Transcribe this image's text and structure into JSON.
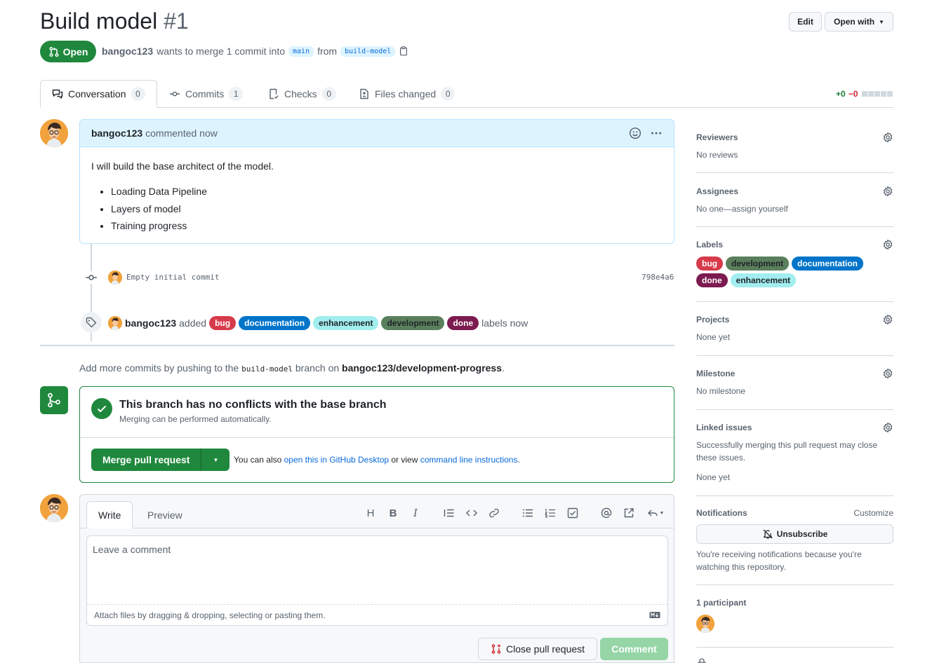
{
  "pr": {
    "title": "Build model",
    "number": "#1",
    "state": "Open",
    "author": "bangoc123",
    "merge_text_1": "wants to merge 1 commit into",
    "base": "main",
    "from_text": "from",
    "head": "build-model"
  },
  "header_buttons": {
    "edit": "Edit",
    "open_with": "Open with"
  },
  "tabs": [
    {
      "label": "Conversation",
      "count": "0"
    },
    {
      "label": "Commits",
      "count": "1"
    },
    {
      "label": "Checks",
      "count": "0"
    },
    {
      "label": "Files changed",
      "count": "0"
    }
  ],
  "diffstat": {
    "added": "+0",
    "removed": "−0"
  },
  "comment": {
    "author": "bangoc123",
    "meta": "commented now",
    "body": "I will build the base architect of the model.",
    "items": [
      "Loading Data Pipeline",
      "Layers of model",
      "Training progress"
    ]
  },
  "commit": {
    "message": "Empty initial commit",
    "sha": "798e4a6"
  },
  "label_event": {
    "author": "bangoc123",
    "verb": "added",
    "suffix": "labels now"
  },
  "labels": [
    {
      "name": "bug",
      "color": "#d73a4a",
      "text": "#ffffff"
    },
    {
      "name": "documentation",
      "color": "#0075ca",
      "text": "#ffffff"
    },
    {
      "name": "enhancement",
      "color": "#a2eeef",
      "text": "#1f2328"
    },
    {
      "name": "development",
      "color": "#5a7f5c",
      "text": "#1f2328"
    },
    {
      "name": "done",
      "color": "#7c1b4f",
      "text": "#ffffff"
    }
  ],
  "push_hint": {
    "prefix": "Add more commits by pushing to the",
    "branch": "build-model",
    "middle": "branch on",
    "repo": "bangoc123/development-progress",
    "suffix": "."
  },
  "merge": {
    "title": "This branch has no conflicts with the base branch",
    "subtitle": "Merging can be performed automatically.",
    "button": "Merge pull request",
    "also": "You can also",
    "desktop_link": "open this in GitHub Desktop",
    "or_view": "or view",
    "cli_link": "command line instructions",
    "end": "."
  },
  "editor": {
    "write_tab": "Write",
    "preview_tab": "Preview",
    "placeholder": "Leave a comment",
    "attach": "Attach files by dragging & dropping, selecting or pasting them.",
    "close_button": "Close pull request",
    "comment_button": "Comment"
  },
  "sidebar": {
    "reviewers": {
      "title": "Reviewers",
      "value": "No reviews"
    },
    "assignees": {
      "title": "Assignees",
      "value": "No one—assign yourself"
    },
    "labels_title": "Labels",
    "sidebar_labels": [
      {
        "name": "bug",
        "color": "#d73a4a",
        "text": "#ffffff"
      },
      {
        "name": "development",
        "color": "#5a7f5c",
        "text": "#1f2328"
      },
      {
        "name": "documentation",
        "color": "#0075ca",
        "text": "#ffffff"
      },
      {
        "name": "done",
        "color": "#7c1b4f",
        "text": "#ffffff"
      },
      {
        "name": "enhancement",
        "color": "#a2eeef",
        "text": "#1f2328"
      }
    ],
    "projects": {
      "title": "Projects",
      "value": "None yet"
    },
    "milestone": {
      "title": "Milestone",
      "value": "No milestone"
    },
    "linked": {
      "title": "Linked issues",
      "desc": "Successfully merging this pull request may close these issues.",
      "value": "None yet"
    },
    "notifications": {
      "title": "Notifications",
      "customize": "Customize",
      "button": "Unsubscribe",
      "desc": "You're receiving notifications because you're watching this repository."
    },
    "participants": {
      "title": "1 participant"
    }
  },
  "colors": {
    "green": "#1f883d",
    "blue": "#0969da",
    "muted": "#59636e",
    "border": "#d1d9e0"
  }
}
